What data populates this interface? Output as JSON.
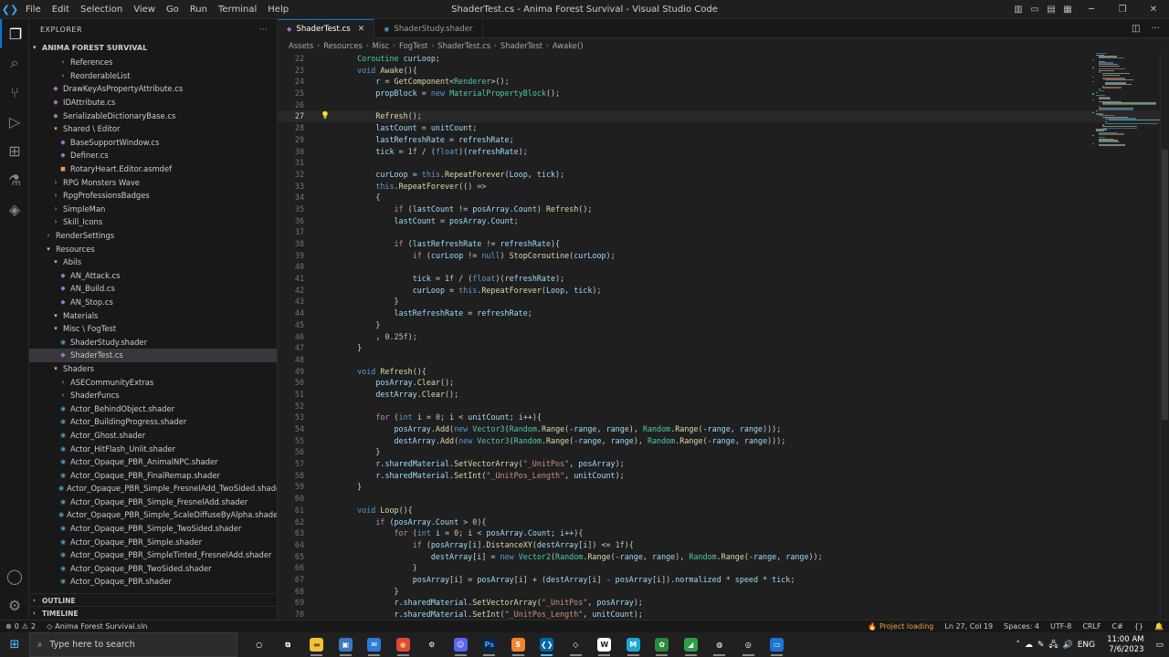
{
  "window": {
    "title": "ShaderTest.cs - Anima Forest Survival - Visual Studio Code",
    "menu": [
      "File",
      "Edit",
      "Selection",
      "View",
      "Go",
      "Run",
      "Terminal",
      "Help"
    ]
  },
  "sidebar": {
    "header": "EXPLORER",
    "project": "ANIMA FOREST SURVIVAL",
    "tree": [
      {
        "label": "References",
        "depth": 3,
        "kind": "folder",
        "open": false
      },
      {
        "label": "ReorderableList",
        "depth": 3,
        "kind": "folder",
        "open": false
      },
      {
        "label": "DrawKeyAsPropertyAttribute.cs",
        "depth": 2,
        "kind": "cs"
      },
      {
        "label": "IDAttribute.cs",
        "depth": 2,
        "kind": "cs"
      },
      {
        "label": "SerializableDictionaryBase.cs",
        "depth": 2,
        "kind": "cs"
      },
      {
        "label": "Shared \\ Editor",
        "depth": 2,
        "kind": "folder",
        "open": true
      },
      {
        "label": "BaseSupportWindow.cs",
        "depth": 3,
        "kind": "cs"
      },
      {
        "label": "Definer.cs",
        "depth": 3,
        "kind": "cs"
      },
      {
        "label": "RotaryHeart.Editor.asmdef",
        "depth": 3,
        "kind": "asm"
      },
      {
        "label": "RPG Monsters Wave",
        "depth": 2,
        "kind": "folder",
        "open": false
      },
      {
        "label": "RpgProfessionsBadges",
        "depth": 2,
        "kind": "folder",
        "open": false
      },
      {
        "label": "SimpleMan",
        "depth": 2,
        "kind": "folder",
        "open": false
      },
      {
        "label": "Skill_Icons",
        "depth": 2,
        "kind": "folder",
        "open": false
      },
      {
        "label": "RenderSettings",
        "depth": 1,
        "kind": "folder",
        "open": false
      },
      {
        "label": "Resources",
        "depth": 1,
        "kind": "folder",
        "open": true
      },
      {
        "label": "Abils",
        "depth": 2,
        "kind": "folder",
        "open": true
      },
      {
        "label": "AN_Attack.cs",
        "depth": 3,
        "kind": "cs"
      },
      {
        "label": "AN_Build.cs",
        "depth": 3,
        "kind": "cs"
      },
      {
        "label": "AN_Stop.cs",
        "depth": 3,
        "kind": "cs"
      },
      {
        "label": "Materials",
        "depth": 2,
        "kind": "folder",
        "open": true
      },
      {
        "label": "Misc \\ FogTest",
        "depth": 2,
        "kind": "folder",
        "open": true
      },
      {
        "label": "ShaderStudy.shader",
        "depth": 3,
        "kind": "shader"
      },
      {
        "label": "ShaderTest.cs",
        "depth": 3,
        "kind": "cs",
        "selected": true
      },
      {
        "label": "Shaders",
        "depth": 2,
        "kind": "folder",
        "open": true
      },
      {
        "label": "ASECommunityExtras",
        "depth": 3,
        "kind": "folder",
        "open": false
      },
      {
        "label": "ShaderFuncs",
        "depth": 3,
        "kind": "folder",
        "open": false
      },
      {
        "label": "Actor_BehindObject.shader",
        "depth": 3,
        "kind": "shader"
      },
      {
        "label": "Actor_BuildingProgress.shader",
        "depth": 3,
        "kind": "shader"
      },
      {
        "label": "Actor_Ghost.shader",
        "depth": 3,
        "kind": "shader"
      },
      {
        "label": "Actor_HitFlash_Unlit.shader",
        "depth": 3,
        "kind": "shader"
      },
      {
        "label": "Actor_Opaque_PBR_AnimalNPC.shader",
        "depth": 3,
        "kind": "shader"
      },
      {
        "label": "Actor_Opaque_PBR_FinalRemap.shader",
        "depth": 3,
        "kind": "shader"
      },
      {
        "label": "Actor_Opaque_PBR_Simple_FresnelAdd_TwoSided.shader",
        "depth": 3,
        "kind": "shader"
      },
      {
        "label": "Actor_Opaque_PBR_Simple_FresnelAdd.shader",
        "depth": 3,
        "kind": "shader"
      },
      {
        "label": "Actor_Opaque_PBR_Simple_ScaleDiffuseByAlpha.shader",
        "depth": 3,
        "kind": "shader"
      },
      {
        "label": "Actor_Opaque_PBR_Simple_TwoSided.shader",
        "depth": 3,
        "kind": "shader"
      },
      {
        "label": "Actor_Opaque_PBR_Simple.shader",
        "depth": 3,
        "kind": "shader"
      },
      {
        "label": "Actor_Opaque_PBR_SimpleTinted_FresnelAdd.shader",
        "depth": 3,
        "kind": "shader"
      },
      {
        "label": "Actor_Opaque_PBR_TwoSided.shader",
        "depth": 3,
        "kind": "shader"
      },
      {
        "label": "Actor_Opaque_PBR.shader",
        "depth": 3,
        "kind": "shader"
      }
    ],
    "outline": "OUTLINE",
    "timeline": "TIMELINE"
  },
  "tabs": [
    {
      "label": "ShaderTest.cs",
      "active": true,
      "kind": "cs"
    },
    {
      "label": "ShaderStudy.shader",
      "active": false,
      "kind": "shader"
    }
  ],
  "breadcrumb": [
    "Assets",
    "Resources",
    "Misc",
    "FogTest",
    "ShaderTest.cs",
    "ShaderTest",
    "Awake()"
  ],
  "editor": {
    "current_line": 27,
    "lines": [
      {
        "n": 22,
        "src": "    Coroutine curLoop;"
      },
      {
        "n": 23,
        "src": "    void Awake(){"
      },
      {
        "n": 24,
        "src": "        r = GetComponent<Renderer>();"
      },
      {
        "n": 25,
        "src": "        propBlock = new MaterialPropertyBlock();"
      },
      {
        "n": 26,
        "src": ""
      },
      {
        "n": 27,
        "src": "        Refresh();"
      },
      {
        "n": 28,
        "src": "        lastCount = unitCount;"
      },
      {
        "n": 29,
        "src": "        lastRefreshRate = refreshRate;"
      },
      {
        "n": 30,
        "src": "        tick = 1f / (float)(refreshRate);"
      },
      {
        "n": 31,
        "src": ""
      },
      {
        "n": 32,
        "src": "        curLoop = this.RepeatForever(Loop, tick);"
      },
      {
        "n": 33,
        "src": "        this.RepeatForever(() =>"
      },
      {
        "n": 34,
        "src": "        {"
      },
      {
        "n": 35,
        "src": "            if (lastCount != posArray.Count) Refresh();"
      },
      {
        "n": 36,
        "src": "            lastCount = posArray.Count;"
      },
      {
        "n": 37,
        "src": ""
      },
      {
        "n": 38,
        "src": "            if (lastRefreshRate != refreshRate){"
      },
      {
        "n": 39,
        "src": "                if (curLoop != null) StopCoroutine(curLoop);"
      },
      {
        "n": 40,
        "src": ""
      },
      {
        "n": 41,
        "src": "                tick = 1f / (float)(refreshRate);"
      },
      {
        "n": 42,
        "src": "                curLoop = this.RepeatForever(Loop, tick);"
      },
      {
        "n": 43,
        "src": "            }"
      },
      {
        "n": 44,
        "src": "            lastRefreshRate = refreshRate;"
      },
      {
        "n": 45,
        "src": "        }"
      },
      {
        "n": 46,
        "src": "        , 0.25f);"
      },
      {
        "n": 47,
        "src": "    }"
      },
      {
        "n": 48,
        "src": ""
      },
      {
        "n": 49,
        "src": "    void Refresh(){"
      },
      {
        "n": 50,
        "src": "        posArray.Clear();"
      },
      {
        "n": 51,
        "src": "        destArray.Clear();"
      },
      {
        "n": 52,
        "src": ""
      },
      {
        "n": 53,
        "src": "        for (int i = 0; i < unitCount; i++){"
      },
      {
        "n": 54,
        "src": "            posArray.Add(new Vector3(Random.Range(-range, range), Random.Range(-range, range)));"
      },
      {
        "n": 55,
        "src": "            destArray.Add(new Vector3(Random.Range(-range, range), Random.Range(-range, range)));"
      },
      {
        "n": 56,
        "src": "        }"
      },
      {
        "n": 57,
        "src": "        r.sharedMaterial.SetVectorArray(\"_UnitPos\", posArray);"
      },
      {
        "n": 58,
        "src": "        r.sharedMaterial.SetInt(\"_UnitPos_Length\", unitCount);"
      },
      {
        "n": 59,
        "src": "    }"
      },
      {
        "n": 60,
        "src": ""
      },
      {
        "n": 61,
        "src": "    void Loop(){"
      },
      {
        "n": 62,
        "src": "        if (posArray.Count > 0){"
      },
      {
        "n": 63,
        "src": "            for (int i = 0; i < posArray.Count; i++){"
      },
      {
        "n": 64,
        "src": "                if (posArray[i].DistanceXY(destArray[i]) <= 1f){"
      },
      {
        "n": 65,
        "src": "                    destArray[i] = new Vector2(Random.Range(-range, range), Random.Range(-range, range));"
      },
      {
        "n": 66,
        "src": "                }"
      },
      {
        "n": 67,
        "src": "                posArray[i] = posArray[i] + (destArray[i] - posArray[i]).normalized * speed * tick;"
      },
      {
        "n": 68,
        "src": "            }"
      },
      {
        "n": 69,
        "src": "            r.sharedMaterial.SetVectorArray(\"_UnitPos\", posArray);"
      },
      {
        "n": 70,
        "src": "            r.sharedMaterial.SetInt(\"_UnitPos_Length\", unitCount);"
      }
    ]
  },
  "statusbar": {
    "errors": "0",
    "warnings": "2",
    "solution": "Anima Forest Survival.sln",
    "project_loading": "Project loading",
    "position": "Ln 27, Col 19",
    "spaces": "Spaces: 4",
    "encoding": "UTF-8",
    "eol": "CRLF",
    "language": "C#"
  },
  "taskbar": {
    "search_placeholder": "Type here to search",
    "time": "11:00 AM",
    "date": "7/6/2023",
    "apps": [
      "cortana-icon",
      "task-view-icon",
      "file-explorer-icon",
      "explorer-window-icon",
      "mail-icon",
      "chrome-icon",
      "settings-icon",
      "discord-icon",
      "photoshop-icon",
      "sublime-icon",
      "vscode-icon",
      "unity-icon",
      "webex-icon",
      "medibang-icon",
      "paint-icon",
      "feather-app-icon",
      "blender-icon",
      "obs-icon",
      "screenshot-app-icon"
    ]
  },
  "colors": {
    "accent": "#0078d4",
    "editor_bg": "#1f1f1f",
    "sidebar_bg": "#181818",
    "keyword": "#569cd6",
    "type": "#4ec9b0",
    "function": "#dcdcaa",
    "string": "#ce9178",
    "number": "#b5cea8"
  }
}
